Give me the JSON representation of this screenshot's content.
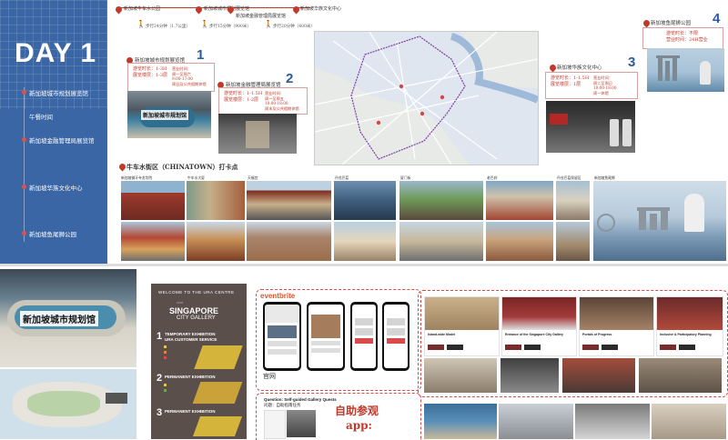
{
  "sidebar": {
    "title": "DAY 1",
    "items": [
      {
        "label": "新加坡城市规划展览馆"
      },
      {
        "label": "午餐时间"
      },
      {
        "label": "新加坡金融管理局展览馆"
      },
      {
        "label": "新加坡华族文化中心"
      },
      {
        "label": "新加坡鱼尾狮公园"
      }
    ]
  },
  "timeline": {
    "stops": [
      {
        "label": "新加坡牛车水公园"
      },
      {
        "label": "新加坡城市规划展览馆"
      },
      {
        "label": "新加坡金融管理局展览馆"
      },
      {
        "label": "新加坡华族文化中心"
      }
    ],
    "legs": [
      {
        "label": "步行24分钟（1.7公里）"
      },
      {
        "label": "步行15分钟（900米）"
      },
      {
        "label": "步行20分钟（400米）"
      }
    ]
  },
  "venues": [
    {
      "number": "1",
      "title": "新加坡城市规划展览馆",
      "info": [
        "游览时长：1-3H",
        "展览楼层：1-3层"
      ],
      "hours": [
        "营业时间：",
        "周一至周六",
        "9:00-17:00",
        "周日及公共假期休馆"
      ],
      "photo_label": "新加坡城市规划馆"
    },
    {
      "number": "2",
      "title": "新加坡金融管理局展览馆",
      "info": [
        "游览时长：1-1.5H",
        "展览楼层：1-2层"
      ],
      "hours": [
        "营业时间：",
        "周一至周五",
        "10:00-18:00",
        "周末及公共假期休馆"
      ]
    },
    {
      "number": "3",
      "title": "新加坡华族文化中心",
      "info": [
        "游览时长：1-1.5H",
        "展览楼层：1层"
      ],
      "hours": [
        "营业时间：",
        "周二至周日",
        "10:00-18:00",
        "周一休馆"
      ]
    },
    {
      "number": "4",
      "title": "新加坡鱼尾狮公园",
      "info": [
        "游览时长：不限",
        "营业时间：24H营业"
      ]
    }
  ],
  "chinatown": {
    "title": "牛车水街区（CHINATOWN）打卡点",
    "captions": [
      "新加坡佛牙寺龙华院",
      "牛车水大厦",
      "天福宫",
      "丹戎巴葛",
      "厦门街",
      "老巴刹",
      "丹戎巴葛保留区",
      "新加坡鱼尾狮"
    ]
  },
  "bottom": {
    "ura_photo_label": "新加坡城市规划馆",
    "brochure": {
      "welcome": "WELCOME TO THE URA CENTRE",
      "brand1": "SINGAPORE",
      "brand2": "CITY GALLERY",
      "sections": [
        {
          "num": "1",
          "title": "TEMPORARY EXHIBITION",
          "sub": "URA CUSTOMER SERVICE"
        },
        {
          "num": "2",
          "title": "PERMANENT EXHIBITION",
          "sub": ""
        },
        {
          "num": "3",
          "title": "PERMANENT EXHIBITION",
          "sub": ""
        }
      ]
    },
    "eventbrite": "eventbrite",
    "official_label": "官网",
    "question": "Question: Self-guided Gallery Quests",
    "question_cn": "问题：自助指南任务",
    "self_guide": "自助参观",
    "app": "app:",
    "cards": [
      {
        "title": "Island-wide Model"
      },
      {
        "title": "Entrance of the Singapore City Gallery"
      },
      {
        "title": "Portals of Progress"
      },
      {
        "title": "Inclusive & Participatory Planning"
      }
    ]
  },
  "colors": {
    "sidebar_bg": "#3a66a5",
    "accent_red": "#c0392b",
    "number_blue": "#2c5aa0",
    "brochure_bg": "#5b4f4c"
  }
}
